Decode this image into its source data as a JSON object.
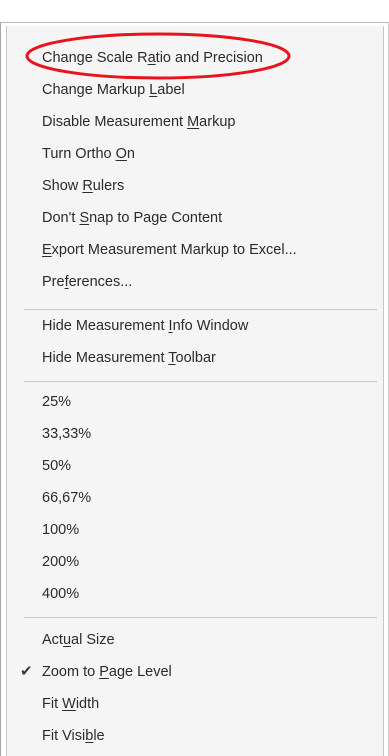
{
  "menu": {
    "group1": [
      {
        "before": "Change Scale R",
        "key": "a",
        "after": "tio and Precision"
      },
      {
        "before": "Change Markup ",
        "key": "L",
        "after": "abel"
      },
      {
        "before": "Disable Measurement ",
        "key": "M",
        "after": "arkup"
      },
      {
        "before": "Turn Ortho ",
        "key": "O",
        "after": "n"
      },
      {
        "before": "Show ",
        "key": "R",
        "after": "ulers"
      },
      {
        "before": "Don't ",
        "key": "S",
        "after": "nap to Page Content"
      },
      {
        "before": "",
        "key": "E",
        "after": "xport Measurement Markup to Excel..."
      },
      {
        "before": "Pre",
        "key": "f",
        "after": "erences..."
      }
    ],
    "group2": [
      {
        "before": "Hide Measurement ",
        "key": "I",
        "after": "nfo Window"
      },
      {
        "before": "Hide Measurement ",
        "key": "T",
        "after": "oolbar"
      }
    ],
    "group3": [
      "25%",
      "33,33%",
      "50%",
      "66,67%",
      "100%",
      "200%",
      "400%"
    ],
    "group4": [
      {
        "before": "Act",
        "key": "u",
        "after": "al Size"
      },
      {
        "before": "Zoom to ",
        "key": "P",
        "after": "age Level"
      },
      {
        "before": "Fit ",
        "key": "W",
        "after": "idth"
      },
      {
        "before": "Fit Visi",
        "key": "b",
        "after": "le"
      }
    ],
    "checked_icon": "check-icon",
    "highlight_color": "#e8141c"
  }
}
